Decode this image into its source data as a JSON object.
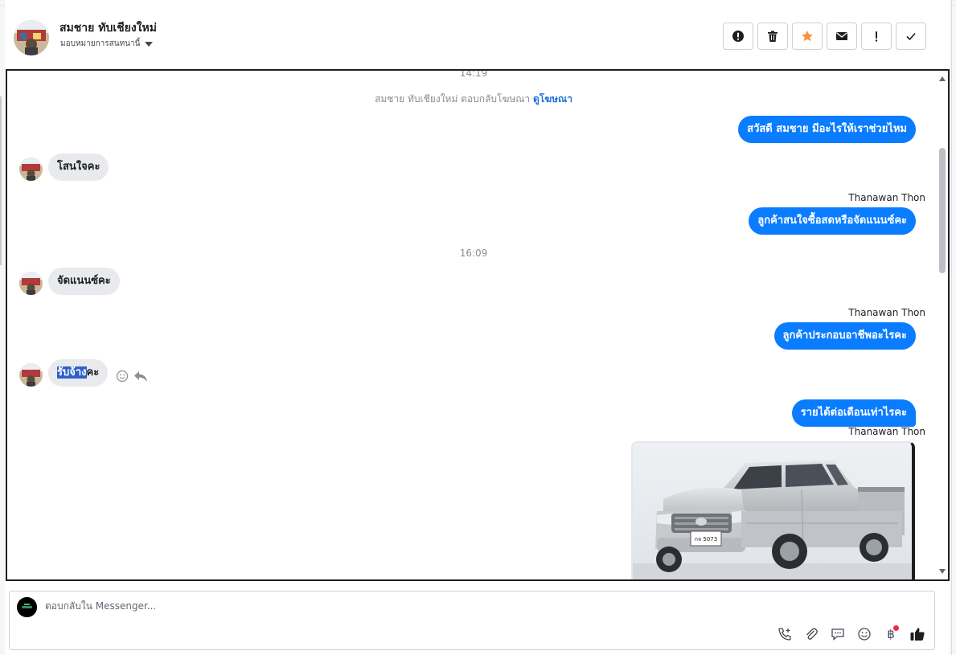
{
  "header": {
    "contact_name": "สมชาย ทับเชียงใหม่",
    "assign_label": "มอบหมายการสนทนานี้",
    "actions": [
      {
        "name": "spam-button",
        "icon": "alert-circle-icon"
      },
      {
        "name": "delete-button",
        "icon": "trash-icon"
      },
      {
        "name": "star-button",
        "icon": "star-icon"
      },
      {
        "name": "mark-unread-button",
        "icon": "envelope-icon"
      },
      {
        "name": "follow-up-button",
        "icon": "exclamation-icon"
      },
      {
        "name": "done-button",
        "icon": "check-icon"
      }
    ]
  },
  "conversation": {
    "timestamp_top": "14:19",
    "system_message": {
      "text": "สมชาย ทับเชียงใหม่ ตอบกลับโฆษณา",
      "link": "ดูโฆษณา"
    },
    "msg1": "สวัสดี สมชาย มีอะไรให้เราช่วยไหม",
    "msg2": "โสนใจคะ",
    "sender1": "Thanawan Thon",
    "msg3": "ลูกค้าสนใจซื้อสดหรือจัดแนนซ์คะ",
    "timestamp_mid": "16:09",
    "msg4": "จัดแนนซ์คะ",
    "sender2": "Thanawan Thon",
    "msg5": "ลูกค้าประกอบอาชีพอะไรคะ",
    "msg6_selected": "รับจ้าง",
    "msg6_rest": "คะ",
    "msg7": "รายได้ต่อเดือนเท่าไรคะ",
    "sender3": "Thanawan Thon",
    "attachment": {
      "type": "image",
      "subject": "silver pickup truck",
      "plate_text": "กจ 5073"
    }
  },
  "composer": {
    "placeholder": "ตอบกลับใน Messenger...",
    "value": "",
    "tools": [
      "call-plus-icon",
      "paperclip-icon",
      "saved-replies-icon",
      "emoji-icon",
      "baht-icon",
      "thumbs-up-icon"
    ]
  },
  "colors": {
    "accent": "#0a7cff",
    "incoming_bubble": "#e9eaed",
    "star": "#f7923b",
    "badge": "#f02849"
  }
}
